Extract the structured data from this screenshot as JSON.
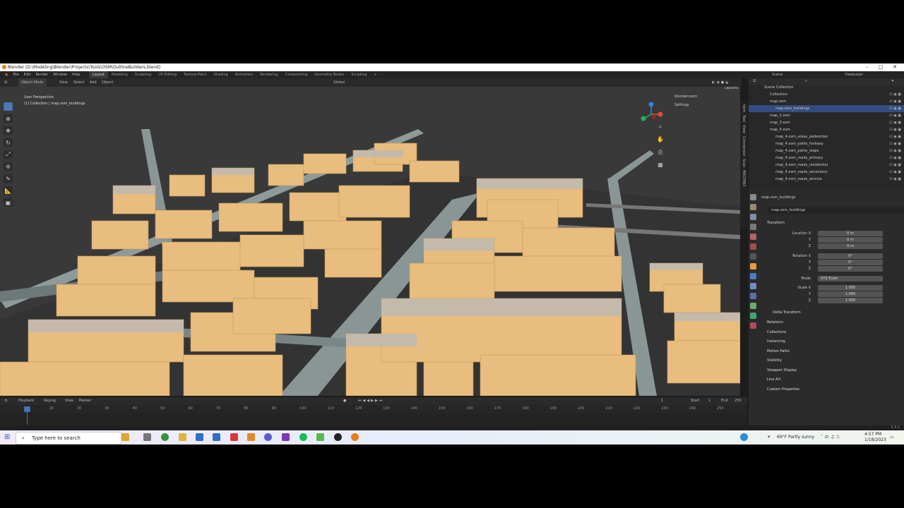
{
  "window": {
    "title": "Blender [D:\\Modeling\\Blender\\Projects\\Tools\\OSM\\OutlineBuilders.blend]",
    "controls": [
      "–",
      "□",
      "✕"
    ]
  },
  "menu": {
    "items": [
      "File",
      "Edit",
      "Render",
      "Window",
      "Help"
    ]
  },
  "workspaces": [
    "Layout",
    "Modeling",
    "Sculpting",
    "UV Editing",
    "Texture Paint",
    "Shading",
    "Animation",
    "Rendering",
    "Compositing",
    "Geometry Nodes",
    "Scripting",
    "+"
  ],
  "scene": {
    "label": "Scene",
    "viewlayer": "ViewLayer"
  },
  "viewport": {
    "mode": "Object Mode",
    "menus": [
      "View",
      "Select",
      "Add",
      "Object"
    ],
    "transform_orientation": "Global",
    "perspective": "User Perspective",
    "collection": "(1) Collection | map.osm_buildings",
    "options": "Options",
    "nav_items": [
      "blendercosm",
      "Settings"
    ],
    "side_tabs": [
      "Item",
      "Tool",
      "View",
      "Connection",
      "Scan",
      "MACHIN3"
    ]
  },
  "timeline": {
    "menus": [
      "Playback",
      "Keying",
      "View",
      "Marker"
    ],
    "current_frame": "1",
    "start_label": "Start",
    "start": "1",
    "end_label": "End",
    "end": "250",
    "ticks": [
      "1",
      "10",
      "20",
      "30",
      "40",
      "50",
      "60",
      "70",
      "80",
      "90",
      "100",
      "110",
      "120",
      "130",
      "140",
      "150",
      "160",
      "170",
      "180",
      "190",
      "200",
      "210",
      "220",
      "230",
      "240",
      "250"
    ]
  },
  "outliner": {
    "title": "Scene Collection",
    "rows": [
      {
        "label": "Collection",
        "indent": 1,
        "selected": false
      },
      {
        "label": "map.osm",
        "indent": 1,
        "selected": false
      },
      {
        "label": "map.osm_buildings",
        "indent": 2,
        "selected": true
      },
      {
        "label": "map_2.osm",
        "indent": 1,
        "selected": false
      },
      {
        "label": "map_3.osm",
        "indent": 1,
        "selected": false
      },
      {
        "label": "map_4.osm",
        "indent": 1,
        "selected": false
      },
      {
        "label": "map_4.osm_areas_pedestrian",
        "indent": 2,
        "selected": false
      },
      {
        "label": "map_4.osm_paths_footway",
        "indent": 2,
        "selected": false
      },
      {
        "label": "map_4.osm_paths_steps",
        "indent": 2,
        "selected": false
      },
      {
        "label": "map_4.osm_roads_primary",
        "indent": 2,
        "selected": false
      },
      {
        "label": "map_4.osm_roads_residential",
        "indent": 2,
        "selected": false
      },
      {
        "label": "map_4.osm_roads_secondary",
        "indent": 2,
        "selected": false
      },
      {
        "label": "map_4.osm_roads_service",
        "indent": 2,
        "selected": false
      }
    ]
  },
  "properties": {
    "object_name": "map.osm_buildings",
    "object_field": "map.osm_buildings",
    "transform": "Transform",
    "location_label": "Location X",
    "location": [
      "0 m",
      "0 m",
      "0 m"
    ],
    "rotation_label": "Rotation X",
    "rotation": [
      "0°",
      "0°",
      "0°"
    ],
    "mode_label": "Mode",
    "mode": "XYZ Euler",
    "scale_label": "Scale X",
    "scale": [
      "1.000",
      "1.000",
      "1.000"
    ],
    "axis_y": "Y",
    "axis_z": "Z",
    "sections": [
      "Delta Transform",
      "Relations",
      "Collections",
      "Instancing",
      "Motion Paths",
      "Visibility",
      "Viewport Display",
      "Line Art",
      "Custom Properties"
    ]
  },
  "version": "3.4.1",
  "taskbar": {
    "search_placeholder": "Type here to search",
    "weather": "69°F  Partly sunny",
    "time": "4:57 PM",
    "date": "1/18/2023"
  },
  "colors": {
    "accent": "#4772b3",
    "building": "#e8bd7e",
    "ground": "#3a3a3a",
    "road": "#8a9596"
  }
}
